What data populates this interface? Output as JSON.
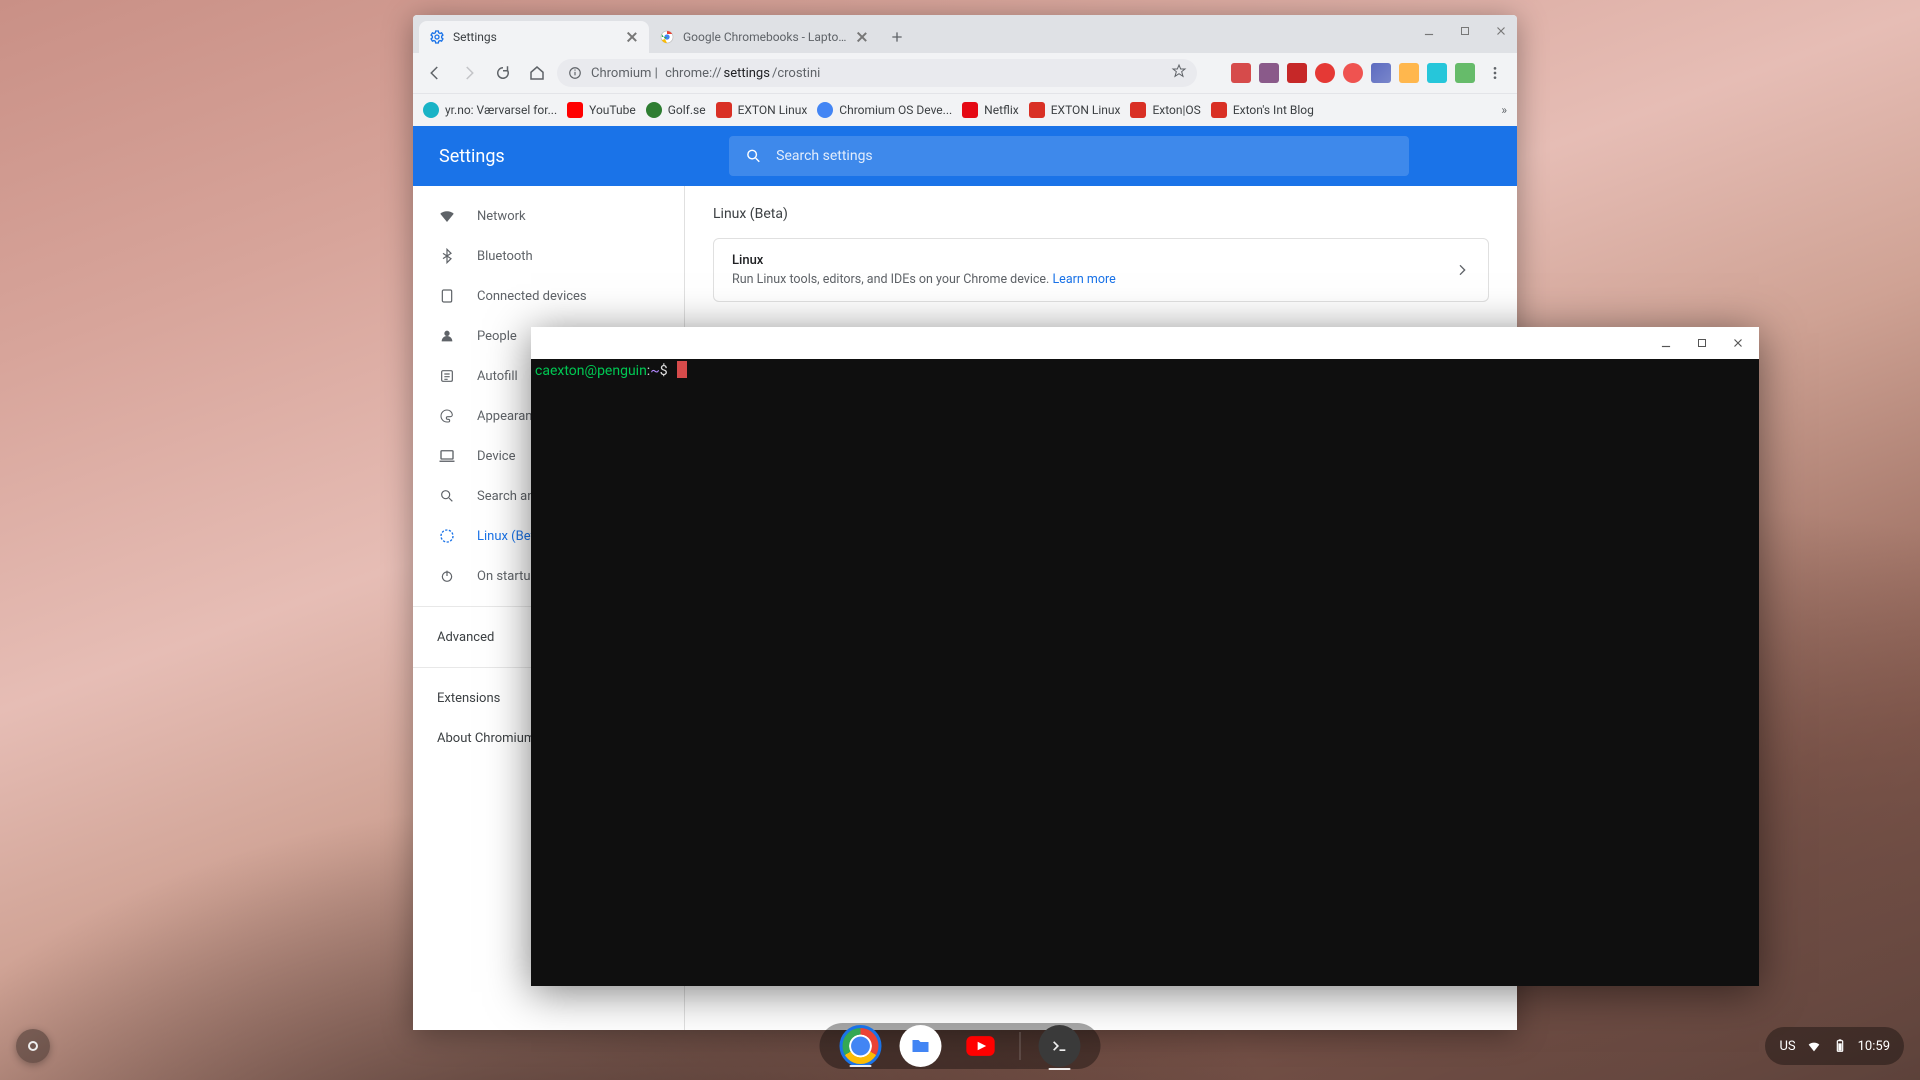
{
  "chrome": {
    "tabs": [
      {
        "title": "Settings"
      },
      {
        "title": "Google Chromebooks - Laptops"
      }
    ],
    "omnibox": {
      "prefix": "Chromium |",
      "url_pre": "chrome://",
      "url_bold": "settings",
      "url_post": "/crostini"
    },
    "bookmarks": [
      {
        "label": "yr.no: Værvarsel for...",
        "color": "#19b3c6"
      },
      {
        "label": "YouTube",
        "color": "#ff0000"
      },
      {
        "label": "Golf.se",
        "color": "#2e7d32"
      },
      {
        "label": "EXTON Linux",
        "color": "#d93025"
      },
      {
        "label": "Chromium OS Deve...",
        "color": "#4285f4"
      },
      {
        "label": "Netflix",
        "color": "#e50914"
      },
      {
        "label": "EXTON Linux",
        "color": "#d93025"
      },
      {
        "label": "Exton|OS",
        "color": "#d93025"
      },
      {
        "label": "Exton's Int Blog",
        "color": "#d93025"
      }
    ]
  },
  "settings": {
    "title": "Settings",
    "search_placeholder": "Search settings",
    "nav": {
      "network": "Network",
      "bluetooth": "Bluetooth",
      "connected_devices": "Connected devices",
      "people": "People",
      "autofill": "Autofill",
      "appearance": "Appearance",
      "device": "Device",
      "search_assistant": "Search and Assistant",
      "linux": "Linux (Beta)",
      "on_startup": "On startup",
      "advanced": "Advanced",
      "extensions": "Extensions",
      "about": "About Chromium OS"
    },
    "section_title": "Linux (Beta)",
    "card": {
      "title": "Linux",
      "desc": "Run Linux tools, editors, and IDEs on your Chrome device. ",
      "learn_more": "Learn more"
    }
  },
  "terminal": {
    "user": "caexton",
    "host": "penguin",
    "path": "~",
    "dollar": "$"
  },
  "shelf": {
    "lang": "US",
    "time": "10:59"
  },
  "icon_colors": {
    "ext1": "#d64b4b",
    "ext2": "#d64b4b",
    "ext3": "#8a5a8a",
    "ext4": "#c62828",
    "ext5": "#e53935",
    "ext6": "#ef5350",
    "ext7": "#7cb342",
    "ext8": "#5c6bc0",
    "ext9": "#ffca28",
    "ext10": "#26a69a",
    "ext11": "#66bb6a"
  }
}
